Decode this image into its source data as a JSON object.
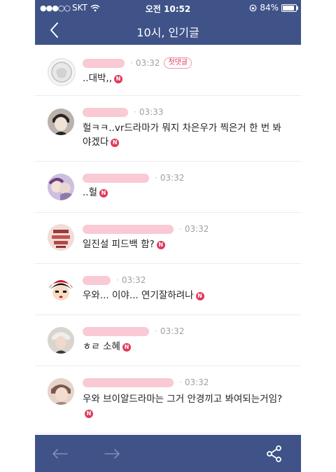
{
  "status_bar": {
    "carrier": "SKT",
    "time": "오전 10:52",
    "battery": "84%"
  },
  "header": {
    "title": "10시, 인기글",
    "back_icon": "chevron-left-icon"
  },
  "comments": [
    {
      "author_prefix": "",
      "time": "03:32",
      "badge": "첫댓글",
      "text": "..대박,,",
      "new_badge": "N"
    },
    {
      "author_prefix": "",
      "time": "03:33",
      "badge": "",
      "text": "헐ㅋㅋ..vr드라마가 뭐지 차은우가 찍은거 한 번 봐야겠다",
      "new_badge": "N"
    },
    {
      "author_prefix": "",
      "time": "03:32",
      "badge": "",
      "text": "..헐",
      "new_badge": "N"
    },
    {
      "author_prefix": "",
      "time": "03:32",
      "badge": "",
      "text": "일진설 피드백 함?",
      "new_badge": "N"
    },
    {
      "author_prefix": "",
      "time": "03:32",
      "badge": "",
      "text": "우와... 이야... 연기잘하려나",
      "new_badge": "N"
    },
    {
      "author_prefix": "",
      "time": "03:32",
      "badge": "",
      "text": "ㅎㄹ 소혜",
      "new_badge": "N"
    },
    {
      "author_prefix": "",
      "time": "03:32",
      "badge": "",
      "text": "우와 브이알드라마는 그거 안경끼고 봐여되는거임?",
      "new_badge": "N"
    }
  ],
  "bottom_bar": {
    "prev_icon": "arrow-left-icon",
    "next_icon": "arrow-right-icon",
    "share_icon": "share-icon"
  }
}
